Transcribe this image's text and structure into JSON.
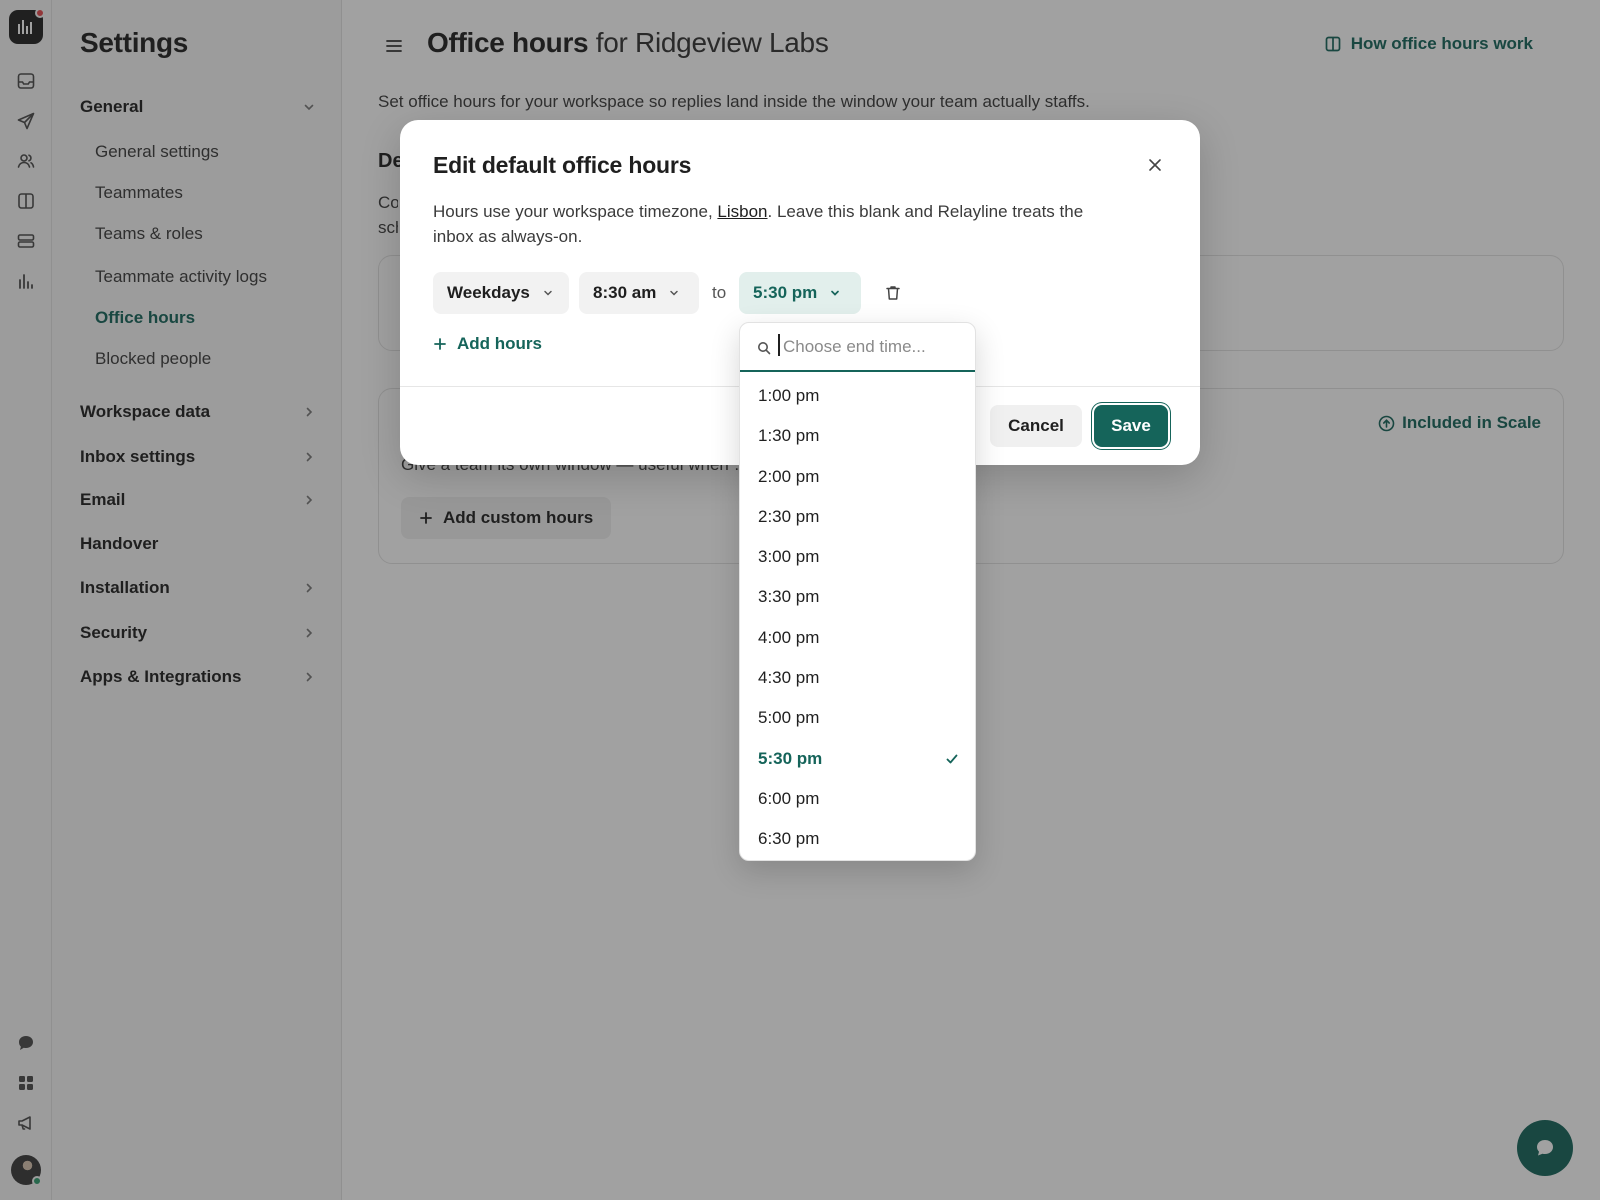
{
  "rail": {
    "icons": [
      "inbox-icon",
      "send-icon",
      "contacts-icon",
      "book-icon",
      "layers-icon",
      "reports-icon",
      "chat-icon",
      "apps-icon",
      "megaphone-icon"
    ]
  },
  "sidebar": {
    "title": "Settings",
    "groups": [
      {
        "label": "General",
        "expanded": true,
        "items": [
          "General settings",
          "Teammates",
          "Teams & roles",
          "Teammate activity logs",
          "Office hours",
          "Blocked people"
        ],
        "active_item": "Office hours"
      },
      {
        "label": "Workspace data",
        "expanded": false
      },
      {
        "label": "Inbox settings",
        "expanded": false
      },
      {
        "label": "Email",
        "expanded": false
      },
      {
        "label": "Handover",
        "expanded": false
      },
      {
        "label": "Installation",
        "expanded": false
      },
      {
        "label": "Security",
        "expanded": false
      },
      {
        "label": "Apps & Integrations",
        "expanded": false
      }
    ]
  },
  "header": {
    "title": "Office hours",
    "title_suffix": "for Ridgeview Labs",
    "help_link": "How office hours work"
  },
  "main": {
    "description": "Set office hours for your workspace so replies land inside the window your team actually staffs.",
    "section_title_partial": "De",
    "section_desc_partial_1": "Co",
    "section_desc_partial_2": "sch",
    "card2": {
      "badge": "Included in Scale",
      "description_visible": "Give a team its own window — useful when … different squad.",
      "button": "Add custom hours"
    }
  },
  "modal": {
    "title": "Edit default office hours",
    "description_prefix": "Hours use your workspace timezone, ",
    "timezone": "Lisbon",
    "description_suffix": ". Leave this blank and Relayline treats the inbox as always-on.",
    "days_select": "Weekdays",
    "start_select": "8:30 am",
    "to_label": "to",
    "end_select": "5:30 pm",
    "add_hours": "Add hours",
    "cancel": "Cancel",
    "save": "Save"
  },
  "dropdown": {
    "placeholder": "Choose end time...",
    "value": "",
    "options": [
      "1:00 pm",
      "1:30 pm",
      "2:00 pm",
      "2:30 pm",
      "3:00 pm",
      "3:30 pm",
      "4:00 pm",
      "4:30 pm",
      "5:00 pm",
      "5:30 pm",
      "6:00 pm",
      "6:30 pm"
    ],
    "selected": "5:30 pm"
  },
  "colors": {
    "accent": "#15645a",
    "accent_soft": "#e2efec",
    "notification": "#e5484d"
  }
}
